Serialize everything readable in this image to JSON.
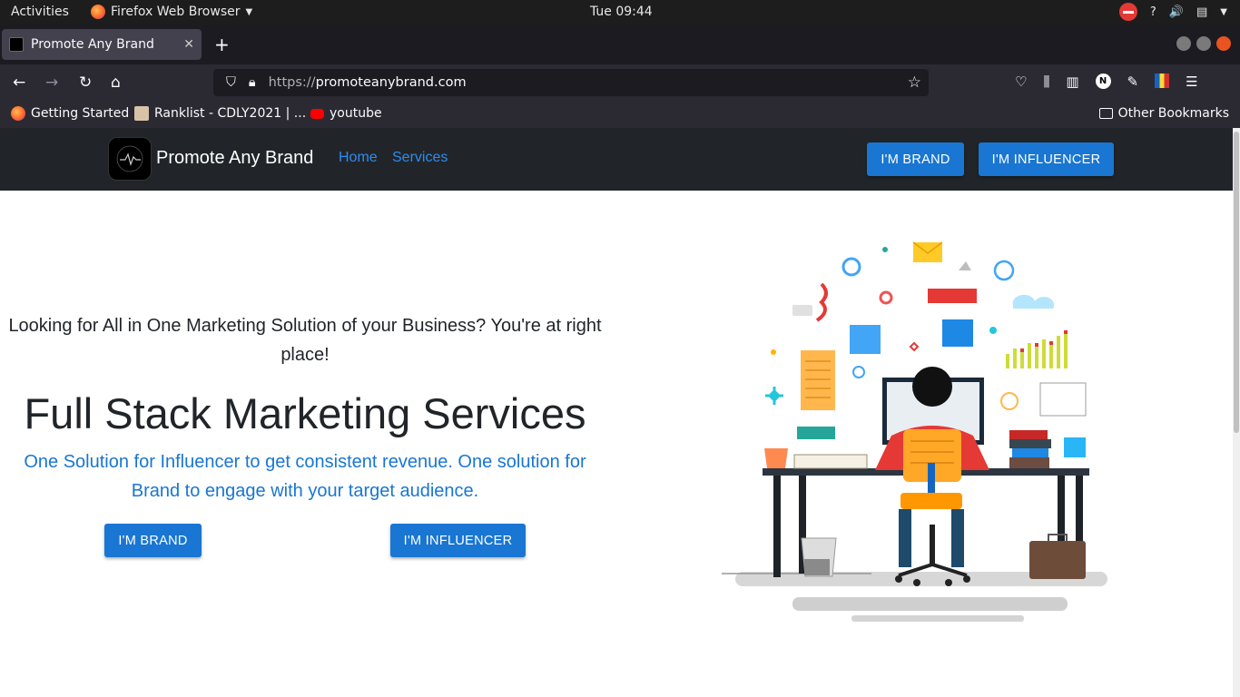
{
  "system": {
    "activities": "Activities",
    "app_name": "Firefox Web Browser",
    "clock": "Tue 09:44"
  },
  "browser": {
    "tab_title": "Promote Any Brand",
    "url_prefix": "https://",
    "url_domain": "promoteanybrand.com",
    "bookmarks": [
      "Getting Started",
      "Ranklist - CDLY2021 | ...",
      "youtube"
    ],
    "other_bookmarks": "Other Bookmarks"
  },
  "site": {
    "brand": "Promote Any Brand",
    "nav": [
      "Home",
      "Services"
    ],
    "header_buttons": {
      "brand": "I'M BRAND",
      "influencer": "I'M INFLUENCER"
    },
    "lead": "Looking for All in One Marketing Solution of your Business? You're at right place!",
    "headline": "Full Stack Marketing Services",
    "subtext": "One Solution for Influencer to get consistent revenue. One solution for Brand to engage with your target audience.",
    "hero_buttons": {
      "brand": "I'M BRAND",
      "influencer": "I'M INFLUENCER"
    }
  },
  "colors": {
    "accent": "#1976d2",
    "nav_link": "#2d8cf0",
    "header_bg": "#212529"
  }
}
